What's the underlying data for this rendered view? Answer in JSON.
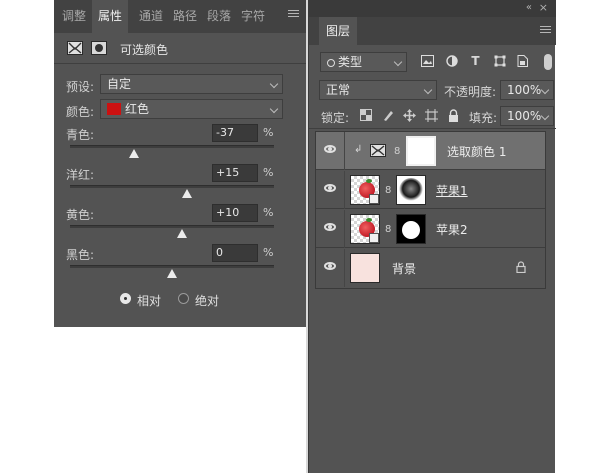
{
  "properties_panel": {
    "tabs": [
      {
        "label": "调整",
        "active": false
      },
      {
        "label": "属性",
        "active": true
      },
      {
        "label": "通道",
        "active": false
      },
      {
        "label": "路径",
        "active": false
      },
      {
        "label": "段落",
        "active": false
      },
      {
        "label": "字符",
        "active": false
      }
    ],
    "header_title": "可选颜色",
    "preset_label": "预设:",
    "preset_value": "自定",
    "color_label": "颜色:",
    "color_value": "红色",
    "color_swatch": "#cc1111",
    "sliders": [
      {
        "label": "青色:",
        "value": "-37",
        "unit": "%",
        "fraction": 0.315
      },
      {
        "label": "洋红:",
        "value": "+15",
        "unit": "%",
        "fraction": 0.575
      },
      {
        "label": "黄色:",
        "value": "+10",
        "unit": "%",
        "fraction": 0.55
      },
      {
        "label": "黑色:",
        "value": "0",
        "unit": "%",
        "fraction": 0.5
      }
    ],
    "method": {
      "relative_label": "相对",
      "absolute_label": "绝对",
      "selected": "relative"
    }
  },
  "layers_panel": {
    "tab_label": "图层",
    "filter_kind": "类型",
    "blend_mode": "正常",
    "opacity_label": "不透明度:",
    "opacity_value": "100%",
    "lock_label": "锁定:",
    "fill_label": "填充:",
    "fill_value": "100%",
    "layers": [
      {
        "name": "选取颜色 1",
        "kind": "adjustment",
        "selected": true
      },
      {
        "name": "苹果1",
        "kind": "smart-object-mask",
        "selected": false
      },
      {
        "name": "苹果2",
        "kind": "smart-object-mask",
        "selected": false
      },
      {
        "name": "背景",
        "kind": "background",
        "selected": false,
        "fill_color": "#f8e2de"
      }
    ]
  },
  "icons": {
    "window_collapse": "«",
    "window_close": "×",
    "panel_menu": "menu-icon",
    "chain": "8"
  }
}
